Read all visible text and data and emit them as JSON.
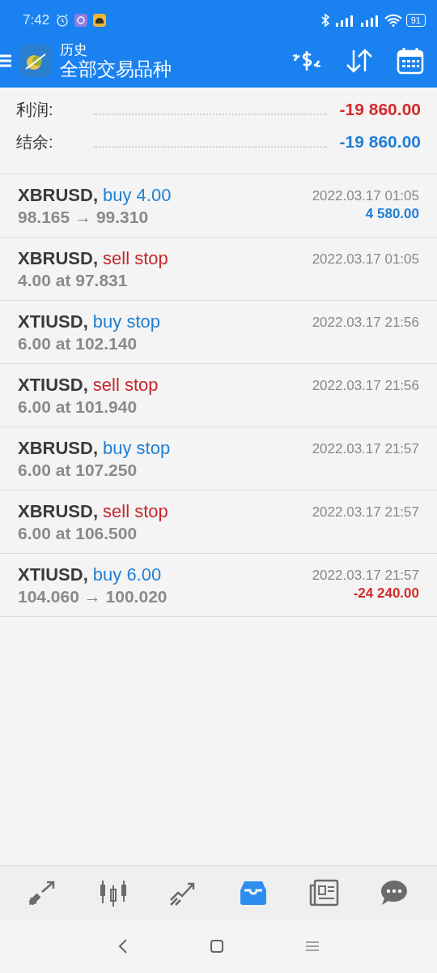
{
  "status_bar": {
    "time": "7:42",
    "battery": "91"
  },
  "header": {
    "title": "历史",
    "subtitle": "全部交易品种"
  },
  "summary": [
    {
      "label": "利润:",
      "value": "-19 860.00",
      "kind": "loss"
    },
    {
      "label": "结余:",
      "value": "-19 860.00",
      "kind": "balance"
    }
  ],
  "deals": [
    {
      "symbol": "XBRUSD,",
      "color": "#1f7fd6",
      "action": "buy 4.00",
      "detail": "98.165 → 99.310",
      "time": "2022.03.17 01:05",
      "profit": {
        "text": "4 580.00",
        "kind": "gain"
      }
    },
    {
      "symbol": "XBRUSD,",
      "color": "#c7262b",
      "action": "sell stop",
      "detail": "4.00 at 97.831",
      "time": "2022.03.17 01:05"
    },
    {
      "symbol": "XTIUSD,",
      "color": "#1f7fd6",
      "action": "buy stop",
      "detail": "6.00 at 102.140",
      "time": "2022.03.17 21:56"
    },
    {
      "symbol": "XTIUSD,",
      "color": "#c7262b",
      "action": "sell stop",
      "detail": "6.00 at 101.940",
      "time": "2022.03.17 21:56"
    },
    {
      "symbol": "XBRUSD,",
      "color": "#1f7fd6",
      "action": "buy stop",
      "detail": "6.00 at 107.250",
      "time": "2022.03.17 21:57"
    },
    {
      "symbol": "XBRUSD,",
      "color": "#c7262b",
      "action": "sell stop",
      "detail": "6.00 at 106.500",
      "time": "2022.03.17 21:57"
    },
    {
      "symbol": "XTIUSD,",
      "color": "#1f7fd6",
      "action": "buy 6.00",
      "detail": "104.060 → 100.020",
      "time": "2022.03.17 21:57",
      "profit": {
        "text": "-24 240.00",
        "kind": "loss"
      }
    }
  ],
  "bottom_nav": [
    {
      "kind": "quotes",
      "selected": false
    },
    {
      "kind": "chart",
      "selected": false
    },
    {
      "kind": "trade",
      "selected": false
    },
    {
      "kind": "history",
      "selected": true
    },
    {
      "kind": "news",
      "selected": false
    },
    {
      "kind": "messages",
      "selected": false
    }
  ]
}
